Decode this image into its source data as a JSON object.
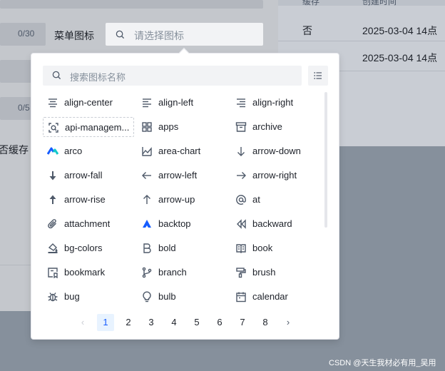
{
  "table": {
    "header": {
      "col1": "缓存",
      "col2": "创建时间"
    },
    "rows": [
      {
        "cache": "否",
        "created": "2025-03-04 14点"
      },
      {
        "cache": "",
        "created": "2025-03-04 14点"
      }
    ]
  },
  "form": {
    "counter_top": "0/30",
    "counter_mid": "0/5",
    "menu_icon_label": "菜单图标",
    "icon_select_placeholder": "请选择图标",
    "cache_label": "否缓存"
  },
  "picker": {
    "search_placeholder": "搜索图标名称",
    "icons": [
      {
        "name": "align-center",
        "icon": "align-center-icon"
      },
      {
        "name": "align-left",
        "icon": "align-left-icon"
      },
      {
        "name": "align-right",
        "icon": "align-right-icon"
      },
      {
        "name": "api-managem...",
        "icon": "api-management-icon"
      },
      {
        "name": "apps",
        "icon": "apps-icon"
      },
      {
        "name": "archive",
        "icon": "archive-icon"
      },
      {
        "name": "arco",
        "icon": "arco-icon"
      },
      {
        "name": "area-chart",
        "icon": "area-chart-icon"
      },
      {
        "name": "arrow-down",
        "icon": "arrow-down-icon"
      },
      {
        "name": "arrow-fall",
        "icon": "arrow-fall-icon"
      },
      {
        "name": "arrow-left",
        "icon": "arrow-left-icon"
      },
      {
        "name": "arrow-right",
        "icon": "arrow-right-icon"
      },
      {
        "name": "arrow-rise",
        "icon": "arrow-rise-icon"
      },
      {
        "name": "arrow-up",
        "icon": "arrow-up-icon"
      },
      {
        "name": "at",
        "icon": "at-icon"
      },
      {
        "name": "attachment",
        "icon": "attachment-icon"
      },
      {
        "name": "backtop",
        "icon": "backtop-icon"
      },
      {
        "name": "backward",
        "icon": "backward-icon"
      },
      {
        "name": "bg-colors",
        "icon": "bg-colors-icon"
      },
      {
        "name": "bold",
        "icon": "bold-icon"
      },
      {
        "name": "book",
        "icon": "book-icon"
      },
      {
        "name": "bookmark",
        "icon": "bookmark-icon"
      },
      {
        "name": "branch",
        "icon": "branch-icon"
      },
      {
        "name": "brush",
        "icon": "brush-icon"
      },
      {
        "name": "bug",
        "icon": "bug-icon"
      },
      {
        "name": "bulb",
        "icon": "bulb-icon"
      },
      {
        "name": "calendar",
        "icon": "calendar-icon"
      }
    ],
    "selected_index": 3,
    "pagination": {
      "pages": [
        "1",
        "2",
        "3",
        "4",
        "5",
        "6",
        "7",
        "8"
      ],
      "current": "1",
      "prev": "‹",
      "next": "›"
    }
  },
  "watermark": "CSDN @天生我材必有用_吴用",
  "colors": {
    "accent": "#165dff",
    "arco_blue": "#165dff",
    "arco_cyan": "#14c9c9"
  }
}
